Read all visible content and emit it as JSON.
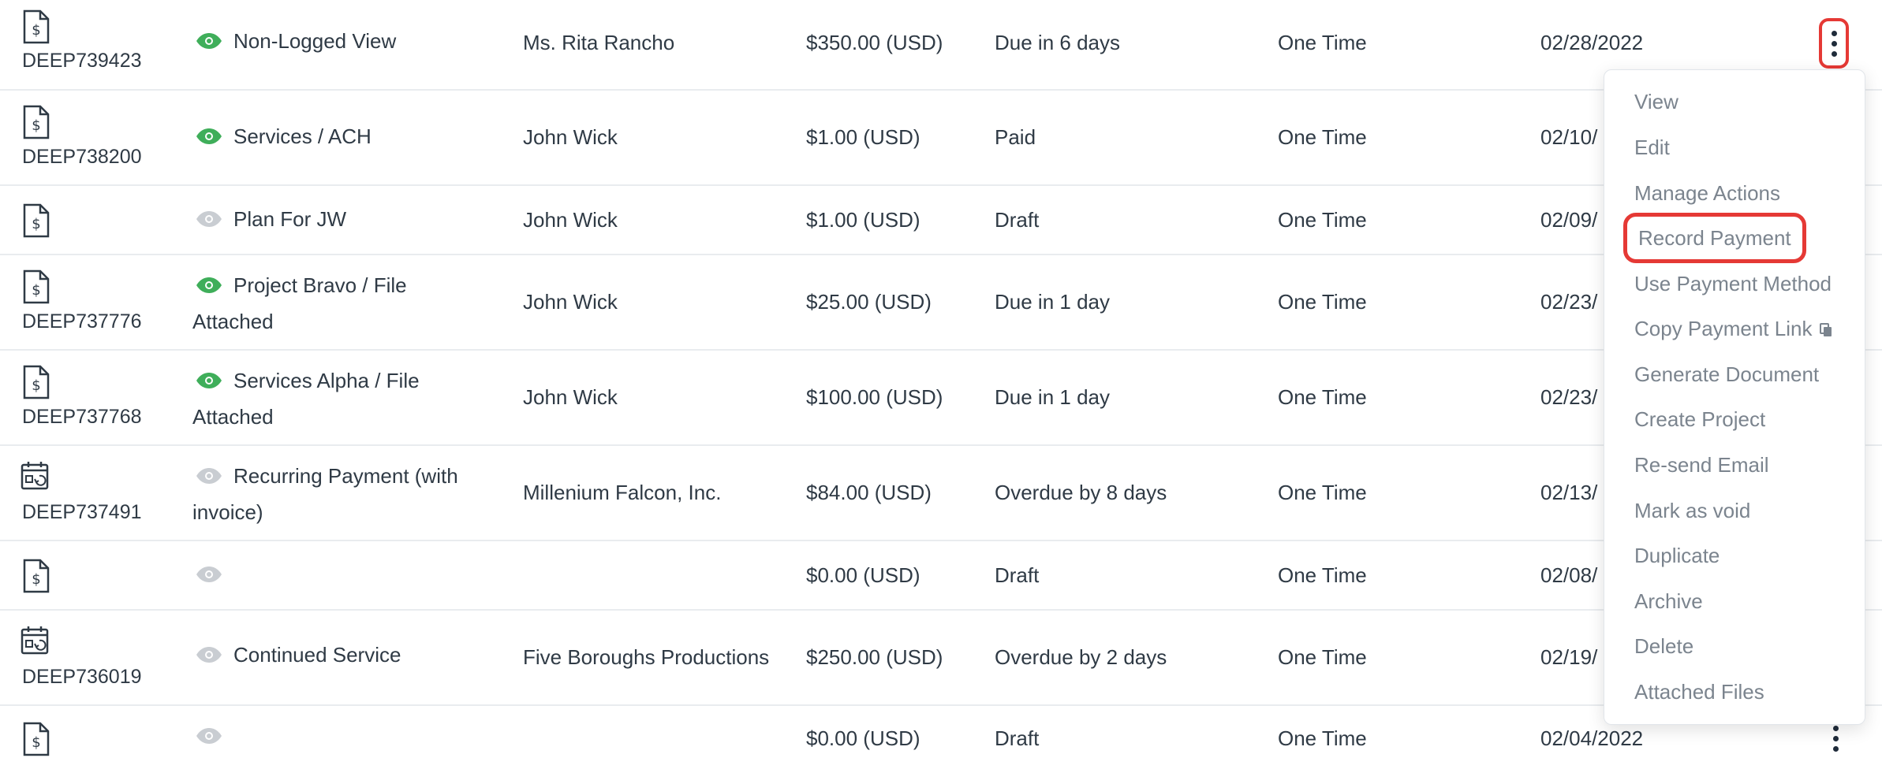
{
  "colors": {
    "eye_active": "#3fae5a",
    "eye_inactive": "#c9cdd2",
    "highlight": "#e53935",
    "menu_text": "#7b848e",
    "text": "#2f3a45"
  },
  "rows": [
    {
      "icon": "invoice-icon",
      "number": "DEEP739423",
      "visible": true,
      "name": "Non-Logged View",
      "client": "Ms. Rita Rancho",
      "amount": "$350.00 (USD)",
      "status": "Due in 6 days",
      "frequency": "One Time",
      "date": "02/28/2022"
    },
    {
      "icon": "invoice-icon",
      "number": "DEEP738200",
      "visible": true,
      "name": "Services / ACH",
      "client": "John Wick",
      "amount": "$1.00 (USD)",
      "status": "Paid",
      "frequency": "One Time",
      "date": "02/10/"
    },
    {
      "icon": "invoice-icon",
      "number": "",
      "visible": false,
      "name": "Plan For JW",
      "client": "John Wick",
      "amount": "$1.00 (USD)",
      "status": "Draft",
      "frequency": "One Time",
      "date": "02/09/"
    },
    {
      "icon": "invoice-icon",
      "number": "DEEP737776",
      "visible": true,
      "name": "Project Bravo / File Attached",
      "client": "John Wick",
      "amount": "$25.00 (USD)",
      "status": "Due in 1 day",
      "frequency": "One Time",
      "date": "02/23/"
    },
    {
      "icon": "invoice-icon",
      "number": "DEEP737768",
      "visible": true,
      "name": "Services Alpha / File Attached",
      "client": "John Wick",
      "amount": "$100.00 (USD)",
      "status": "Due in 1 day",
      "frequency": "One Time",
      "date": "02/23/"
    },
    {
      "icon": "recurring-calendar-icon",
      "number": "DEEP737491",
      "visible": false,
      "name": "Recurring Payment (with invoice)",
      "client": "Millenium Falcon, Inc.",
      "amount": "$84.00 (USD)",
      "status": "Overdue by 8 days",
      "frequency": "One Time",
      "date": "02/13/"
    },
    {
      "icon": "invoice-icon",
      "number": "",
      "visible": false,
      "name": "",
      "client": "",
      "amount": "$0.00 (USD)",
      "status": "Draft",
      "frequency": "One Time",
      "date": "02/08/"
    },
    {
      "icon": "recurring-calendar-icon",
      "number": "DEEP736019",
      "visible": false,
      "name": "Continued Service",
      "client": "Five Boroughs Productions",
      "amount": "$250.00 (USD)",
      "status": "Overdue by 2 days",
      "frequency": "One Time",
      "date": "02/19/"
    },
    {
      "icon": "invoice-icon",
      "number": "",
      "visible": false,
      "name": "",
      "client": "",
      "amount": "$0.00 (USD)",
      "status": "Draft",
      "frequency": "One Time",
      "date": "02/04/2022"
    }
  ],
  "menu": {
    "items": [
      "View",
      "Edit",
      "Manage Actions",
      "Record Payment",
      "Use Payment Method",
      "Copy Payment Link",
      "Generate Document",
      "Create Project",
      "Re-send Email",
      "Mark as void",
      "Duplicate",
      "Archive",
      "Delete",
      "Attached Files"
    ],
    "highlighted": "Record Payment"
  }
}
